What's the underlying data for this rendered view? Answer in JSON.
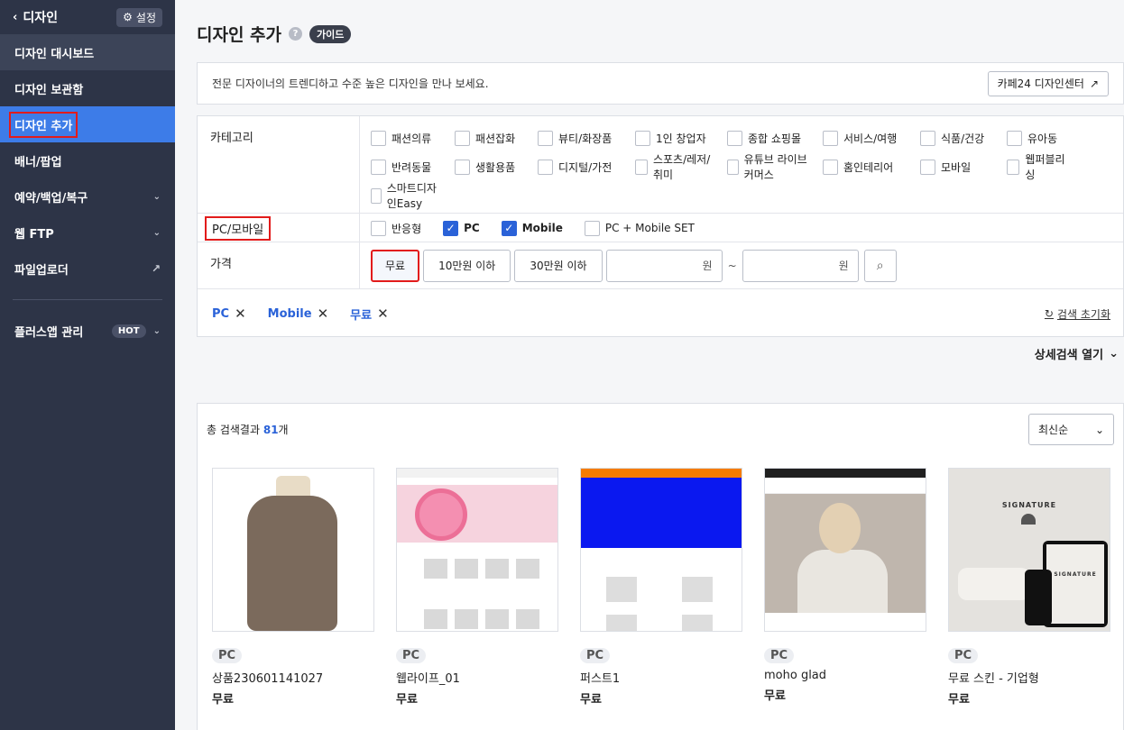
{
  "sidebar": {
    "back_label": "디자인",
    "setting_label": "설정",
    "items": [
      {
        "label": "디자인 대시보드"
      },
      {
        "label": "디자인 보관함"
      },
      {
        "label": "디자인 추가"
      },
      {
        "label": "배너/팝업"
      },
      {
        "label": "예약/백업/복구"
      },
      {
        "label": "웹 FTP"
      },
      {
        "label": "파일업로더"
      }
    ],
    "plus_app": {
      "label": "플러스앱 관리",
      "badge": "HOT"
    }
  },
  "page": {
    "title": "디자인 추가",
    "guide_badge": "가이드",
    "intro_text": "전문 디자이너의 트렌디하고 수준 높은 디자인을 만나 보세요.",
    "center_button": "카페24 디자인센터"
  },
  "filters": {
    "category_label": "카테고리",
    "categories": [
      "패션의류",
      "패션잡화",
      "뷰티/화장품",
      "1인 창업자",
      "종합 쇼핑몰",
      "서비스/여행",
      "식품/건강",
      "유아동",
      "반려동물",
      "생활용품",
      "디지털/가전",
      "스포츠/레저/취미",
      "유튜브 라이브커머스",
      "홈인테리어",
      "모바일",
      "웹퍼블리싱",
      "스마트디자인Easy"
    ],
    "device_label": "PC/모바일",
    "devices": [
      {
        "label": "반응형",
        "checked": false
      },
      {
        "label": "PC",
        "checked": true
      },
      {
        "label": "Mobile",
        "checked": true
      },
      {
        "label": "PC + Mobile SET",
        "checked": false
      }
    ],
    "price_label": "가격",
    "price_buttons": [
      "무료",
      "10만원 이하",
      "30만원 이하"
    ],
    "price_unit": "원",
    "tilde": "~"
  },
  "tags": {
    "items": [
      "PC",
      "Mobile",
      "무료"
    ],
    "reset_label": "검색 초기화"
  },
  "advanced_label": "상세검색 열기",
  "results": {
    "count_prefix": "총 검색결과 ",
    "count": "81",
    "count_suffix": "개",
    "sort": "최신순",
    "cards": [
      {
        "badge": "PC",
        "name": "상품230601141027",
        "price": "무료"
      },
      {
        "badge": "PC",
        "name": "웹라이프_01",
        "price": "무료"
      },
      {
        "badge": "PC",
        "name": "퍼스트1",
        "price": "무료"
      },
      {
        "badge": "PC",
        "name": "moho glad",
        "price": "무료"
      },
      {
        "badge": "PC",
        "name": "무료 스킨 - 기업형",
        "price": "무료"
      }
    ],
    "thumb_text": {
      "sig": "SIGNATURE"
    }
  }
}
